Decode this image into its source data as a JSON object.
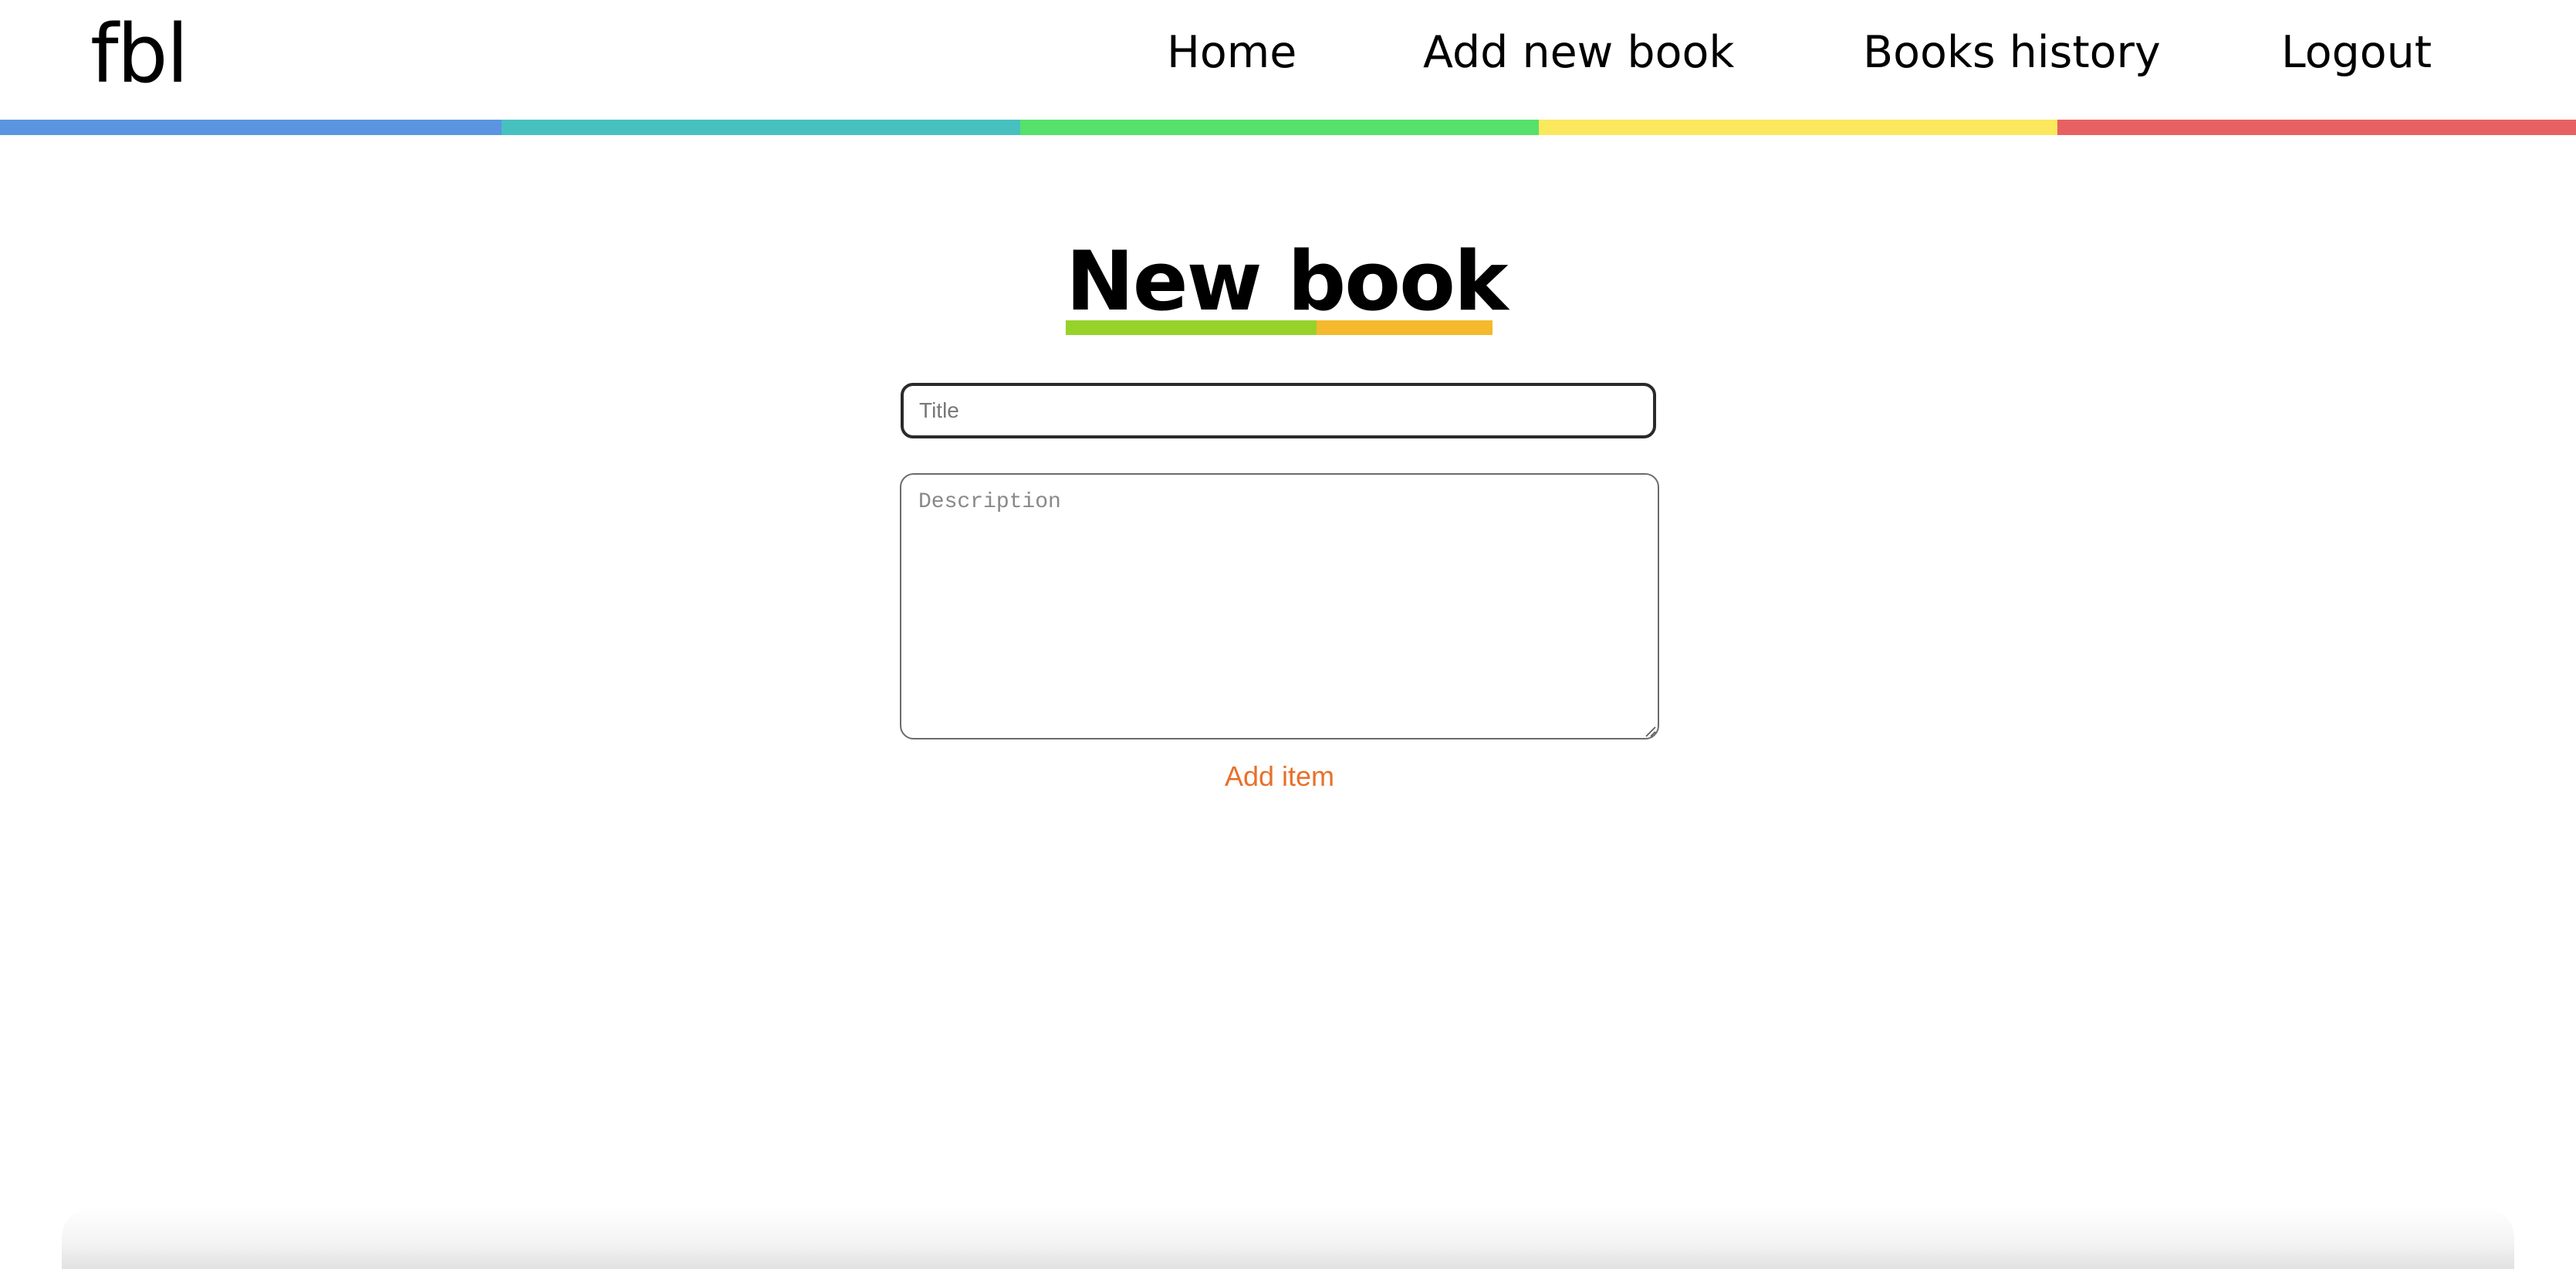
{
  "header": {
    "logo_text": "fbl",
    "nav": [
      {
        "label": "Home"
      },
      {
        "label": "Add new book"
      },
      {
        "label": "Books history"
      },
      {
        "label": "Logout"
      }
    ]
  },
  "colors": {
    "stripe": [
      "#5b95e0",
      "#47c1c0",
      "#57e06a",
      "#fbe85d",
      "#e86162"
    ],
    "title_underline": [
      "#97d22a",
      "#f4b92c"
    ],
    "button_text": "#e8702a"
  },
  "main": {
    "page_title": "New book",
    "title_field": {
      "value": "",
      "placeholder": "Title"
    },
    "description_field": {
      "value": "",
      "placeholder": "Description"
    },
    "submit_label": "Add item"
  }
}
